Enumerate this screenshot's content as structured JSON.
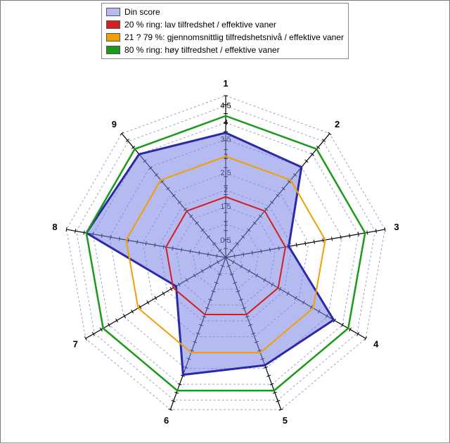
{
  "chart_data": {
    "type": "radar",
    "axes": [
      "1",
      "2",
      "3",
      "4",
      "5",
      "6",
      "7",
      "8",
      "9"
    ],
    "r_ticks": [
      0.5,
      1,
      1.5,
      2,
      2.5,
      3,
      3.5,
      4,
      4.5
    ],
    "r_max": 4.8,
    "series": [
      {
        "name": "Din score",
        "values": [
          3.7,
          3.5,
          1.9,
          3.7,
          3.4,
          3.7,
          1.7,
          4.2,
          4.0
        ],
        "fill": "rgba(120,130,230,0.55)",
        "stroke": "#2a2aa8",
        "stroke_w": 3,
        "filled": true
      },
      {
        "name": "20 % ring: lav tilfredshet / effektive vaner",
        "values": [
          1.8,
          1.8,
          1.8,
          1.8,
          1.8,
          1.8,
          1.8,
          1.8,
          1.8
        ],
        "fill": "none",
        "stroke": "#d22020",
        "stroke_w": 2,
        "filled": false
      },
      {
        "name": "21 ? 79 %: gjennomsnittlig tilfredshetsnivå / effektive vaner",
        "values": [
          3.0,
          3.0,
          3.0,
          3.0,
          3.0,
          3.0,
          3.0,
          3.0,
          3.0
        ],
        "fill": "none",
        "stroke": "#f0a000",
        "stroke_w": 2,
        "filled": false
      },
      {
        "name": "80 % ring: høy tilfredshet / effektive vaner",
        "values": [
          4.2,
          4.2,
          4.2,
          4.2,
          4.2,
          4.2,
          4.2,
          4.2,
          4.2
        ],
        "fill": "none",
        "stroke": "#1a9a1a",
        "stroke_w": 2.5,
        "filled": false
      }
    ],
    "legend_swatches": [
      "rgba(120,130,230,0.55)",
      "#d22020",
      "#f0a000",
      "#1a9a1a"
    ]
  },
  "legend": {
    "items": [
      "Din score",
      "20 % ring: lav tilfredshet / effektive vaner",
      "21 ? 79 %: gjennomsnittlig tilfredshetsnivå / effektive vaner",
      "80 % ring: høy tilfredshet / effektive vaner"
    ]
  }
}
